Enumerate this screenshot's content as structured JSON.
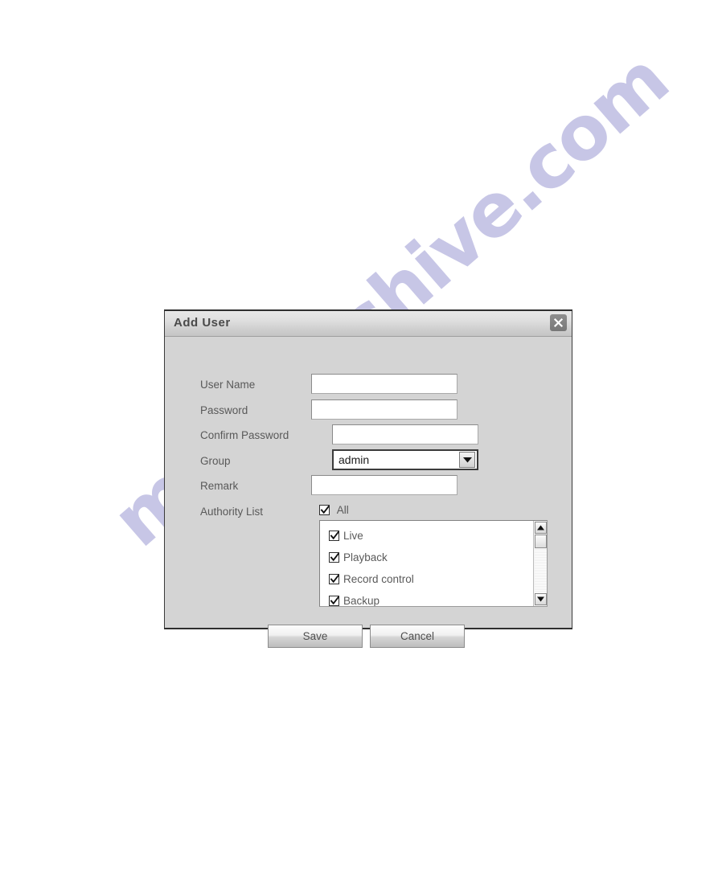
{
  "watermark": {
    "text": "manualshive.com"
  },
  "dialog": {
    "title": "Add User",
    "close_label": "close-icon",
    "fields": [
      {
        "label": "User Name",
        "value": "",
        "type": "text"
      },
      {
        "label": "Password",
        "value": "",
        "type": "text"
      },
      {
        "label": "Confirm Password",
        "value": "",
        "type": "text"
      },
      {
        "label": "Group",
        "value": "admin",
        "type": "select"
      },
      {
        "label": "Remark",
        "value": "",
        "type": "text"
      }
    ],
    "authority": {
      "label": "Authority List",
      "all_label": "All",
      "all_checked": true,
      "items": [
        {
          "label": "Live",
          "checked": true
        },
        {
          "label": "Playback",
          "checked": true
        },
        {
          "label": "Record control",
          "checked": true
        },
        {
          "label": "Backup",
          "checked": true
        }
      ]
    },
    "buttons": {
      "save": "Save",
      "cancel": "Cancel"
    },
    "colors": {
      "dialog_bg": "#d4d4d4",
      "titlebar_text": "#4a4a4a",
      "label_text": "#595959",
      "field_bg": "#ffffff",
      "watermark": "#c3c2e4"
    }
  }
}
